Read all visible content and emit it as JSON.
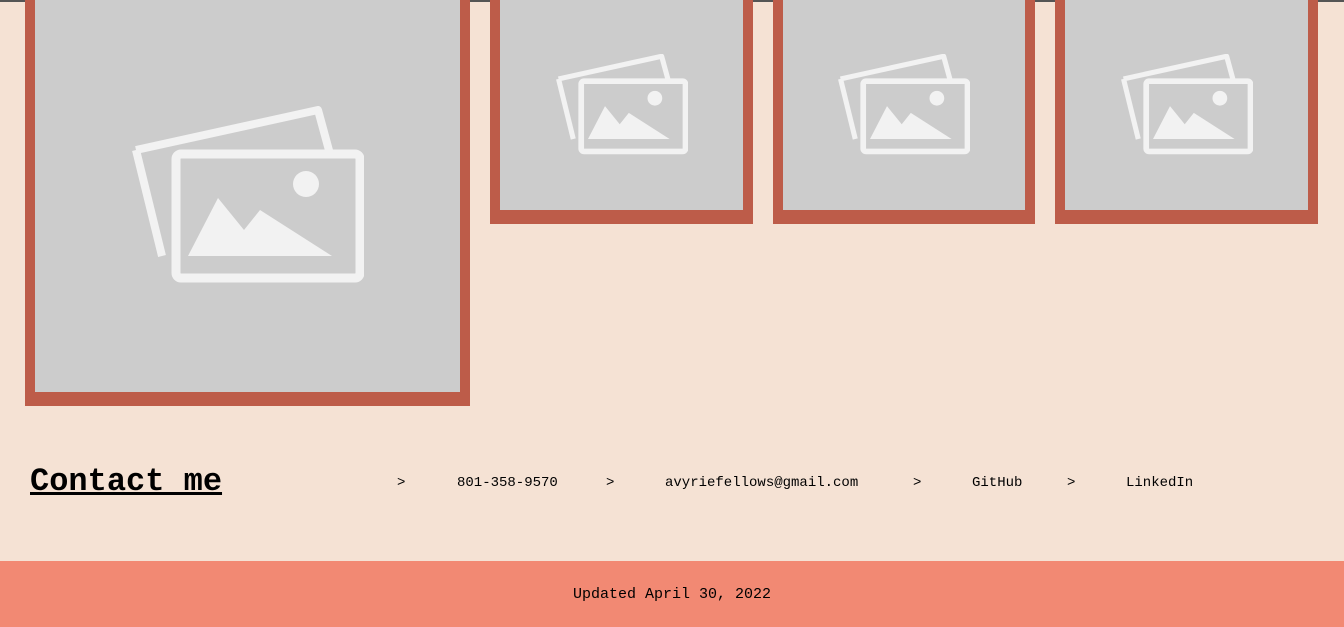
{
  "gallery": {
    "images": [
      {
        "icon": "image-placeholder-icon"
      },
      {
        "icon": "image-placeholder-icon"
      },
      {
        "icon": "image-placeholder-icon"
      },
      {
        "icon": "image-placeholder-icon"
      }
    ]
  },
  "contact": {
    "title": "Contact me",
    "separator": ">",
    "items": [
      {
        "label": "801-358-9570"
      },
      {
        "label": "avyriefellows@gmail.com"
      },
      {
        "label": "GitHub"
      },
      {
        "label": "LinkedIn"
      }
    ]
  },
  "footer": {
    "text": "Updated April 30, 2022"
  },
  "colors": {
    "background": "#f5e2d4",
    "frame": "#bd5c49",
    "placeholder": "#cccccc",
    "footer": "#f28973"
  }
}
